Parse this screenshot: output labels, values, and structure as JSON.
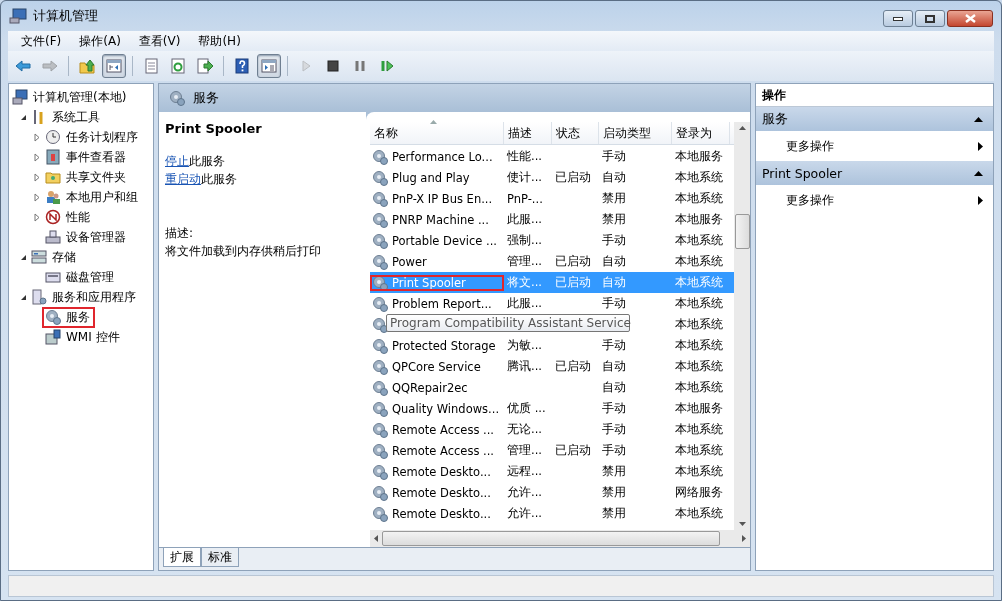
{
  "window": {
    "title": "计算机管理"
  },
  "menu": [
    "文件(F)",
    "操作(A)",
    "查看(V)",
    "帮助(H)"
  ],
  "toolbar": [
    {
      "kind": "back",
      "disabled": false,
      "pressed": false
    },
    {
      "kind": "forward",
      "disabled": true,
      "pressed": false
    },
    {
      "kind": "sep"
    },
    {
      "kind": "up",
      "disabled": false,
      "pressed": false
    },
    {
      "kind": "tree",
      "disabled": false,
      "pressed": true
    },
    {
      "kind": "sep"
    },
    {
      "kind": "properties",
      "disabled": false,
      "pressed": false
    },
    {
      "kind": "refresh",
      "disabled": false,
      "pressed": false
    },
    {
      "kind": "export",
      "disabled": false,
      "pressed": false
    },
    {
      "kind": "sep"
    },
    {
      "kind": "help",
      "disabled": false,
      "pressed": false
    },
    {
      "kind": "pane",
      "disabled": false,
      "pressed": true
    },
    {
      "kind": "sep"
    },
    {
      "kind": "play",
      "disabled": true,
      "pressed": false
    },
    {
      "kind": "stop",
      "disabled": false,
      "pressed": false
    },
    {
      "kind": "pause",
      "disabled": false,
      "pressed": false
    },
    {
      "kind": "resume",
      "disabled": false,
      "pressed": false
    }
  ],
  "tree": [
    {
      "label": "计算机管理(本地)",
      "highlighted": false,
      "children": [
        {
          "label": "系统工具",
          "expanded": true,
          "highlighted": false,
          "children": [
            {
              "label": "任务计划程序",
              "expanded": false,
              "highlighted": false
            },
            {
              "label": "事件查看器",
              "expanded": false,
              "highlighted": false
            },
            {
              "label": "共享文件夹",
              "expanded": false,
              "highlighted": false
            },
            {
              "label": "本地用户和组",
              "expanded": false,
              "highlighted": false
            },
            {
              "label": "性能",
              "expanded": false,
              "highlighted": false
            },
            {
              "label": "设备管理器",
              "highlighted": false
            }
          ]
        },
        {
          "label": "存储",
          "expanded": true,
          "highlighted": false,
          "children": [
            {
              "label": "磁盘管理",
              "highlighted": false
            }
          ]
        },
        {
          "label": "服务和应用程序",
          "expanded": true,
          "highlighted": false,
          "children": [
            {
              "label": "服务",
              "highlighted": true
            },
            {
              "label": "WMI 控件",
              "highlighted": false
            }
          ]
        }
      ]
    }
  ],
  "services": {
    "title": "服务",
    "detail": {
      "name": "Print Spooler",
      "links": [
        {
          "link": "停止",
          "text": "此服务"
        },
        {
          "link": "重启动",
          "text": "此服务"
        }
      ],
      "description_label": "描述:",
      "description": "将文件加载到内存供稍后打印"
    },
    "columns": [
      "名称",
      "描述",
      "状态",
      "启动类型",
      "登录为"
    ],
    "rows": [
      {
        "name": "Performance Lo...",
        "desc": "性能...",
        "startup": "手动",
        "logon": "本地服务",
        "selected": false,
        "highlighted": false
      },
      {
        "name": "Plug and Play",
        "desc": "使计...",
        "status": "已启动",
        "startup": "自动",
        "logon": "本地系统",
        "selected": false,
        "highlighted": false
      },
      {
        "name": "PnP-X IP Bus En...",
        "desc": "PnP-...",
        "startup": "禁用",
        "logon": "本地系统",
        "selected": false,
        "highlighted": false
      },
      {
        "name": "PNRP Machine ...",
        "desc": "此服...",
        "startup": "禁用",
        "logon": "本地服务",
        "selected": false,
        "highlighted": false
      },
      {
        "name": "Portable Device ...",
        "desc": "强制...",
        "startup": "手动",
        "logon": "本地系统",
        "selected": false,
        "highlighted": false
      },
      {
        "name": "Power",
        "desc": "管理...",
        "status": "已启动",
        "startup": "自动",
        "logon": "本地系统",
        "selected": false,
        "highlighted": false
      },
      {
        "name": "Print Spooler",
        "desc": "将文...",
        "status": "已启动",
        "startup": "自动",
        "logon": "本地系统",
        "selected": true,
        "highlighted": true
      },
      {
        "name": "Problem Report...",
        "desc": "此服...",
        "startup": "手动",
        "logon": "本地系统",
        "selected": false,
        "highlighted": false
      },
      {
        "tooltip": "Program Compatibility Assistant Service",
        "logon": "本地系统",
        "selected": false,
        "highlighted": false
      },
      {
        "name": "Protected Storage",
        "desc": "为敏...",
        "startup": "手动",
        "logon": "本地系统",
        "selected": false,
        "highlighted": false
      },
      {
        "name": "QPCore Service",
        "desc": "腾讯...",
        "status": "已启动",
        "startup": "自动",
        "logon": "本地系统",
        "selected": false,
        "highlighted": false
      },
      {
        "name": "QQRepair2ec",
        "startup": "自动",
        "logon": "本地系统",
        "selected": false,
        "highlighted": false
      },
      {
        "name": "Quality Windows...",
        "desc": "优质 ...",
        "startup": "手动",
        "logon": "本地服务",
        "selected": false,
        "highlighted": false
      },
      {
        "name": "Remote Access ...",
        "desc": "无论...",
        "startup": "手动",
        "logon": "本地系统",
        "selected": false,
        "highlighted": false
      },
      {
        "name": "Remote Access ...",
        "desc": "管理...",
        "status": "已启动",
        "startup": "手动",
        "logon": "本地系统",
        "selected": false,
        "highlighted": false
      },
      {
        "name": "Remote Deskto...",
        "desc": "远程...",
        "startup": "禁用",
        "logon": "本地系统",
        "selected": false,
        "highlighted": false
      },
      {
        "name": "Remote Deskto...",
        "desc": "允许...",
        "startup": "禁用",
        "logon": "网络服务",
        "selected": false,
        "highlighted": false
      },
      {
        "name": "Remote Deskto...",
        "desc": "允许...",
        "startup": "禁用",
        "logon": "本地系统",
        "selected": false,
        "highlighted": false
      }
    ],
    "tabs": [
      {
        "label": "扩展",
        "selected": true
      },
      {
        "label": "标准",
        "selected": false
      }
    ]
  },
  "actions": {
    "title": "操作",
    "sections": [
      {
        "title": "服务",
        "expanded": true,
        "items": [
          "更多操作"
        ]
      },
      {
        "title": "Print Spooler",
        "expanded": true,
        "items": [
          "更多操作"
        ]
      }
    ]
  }
}
